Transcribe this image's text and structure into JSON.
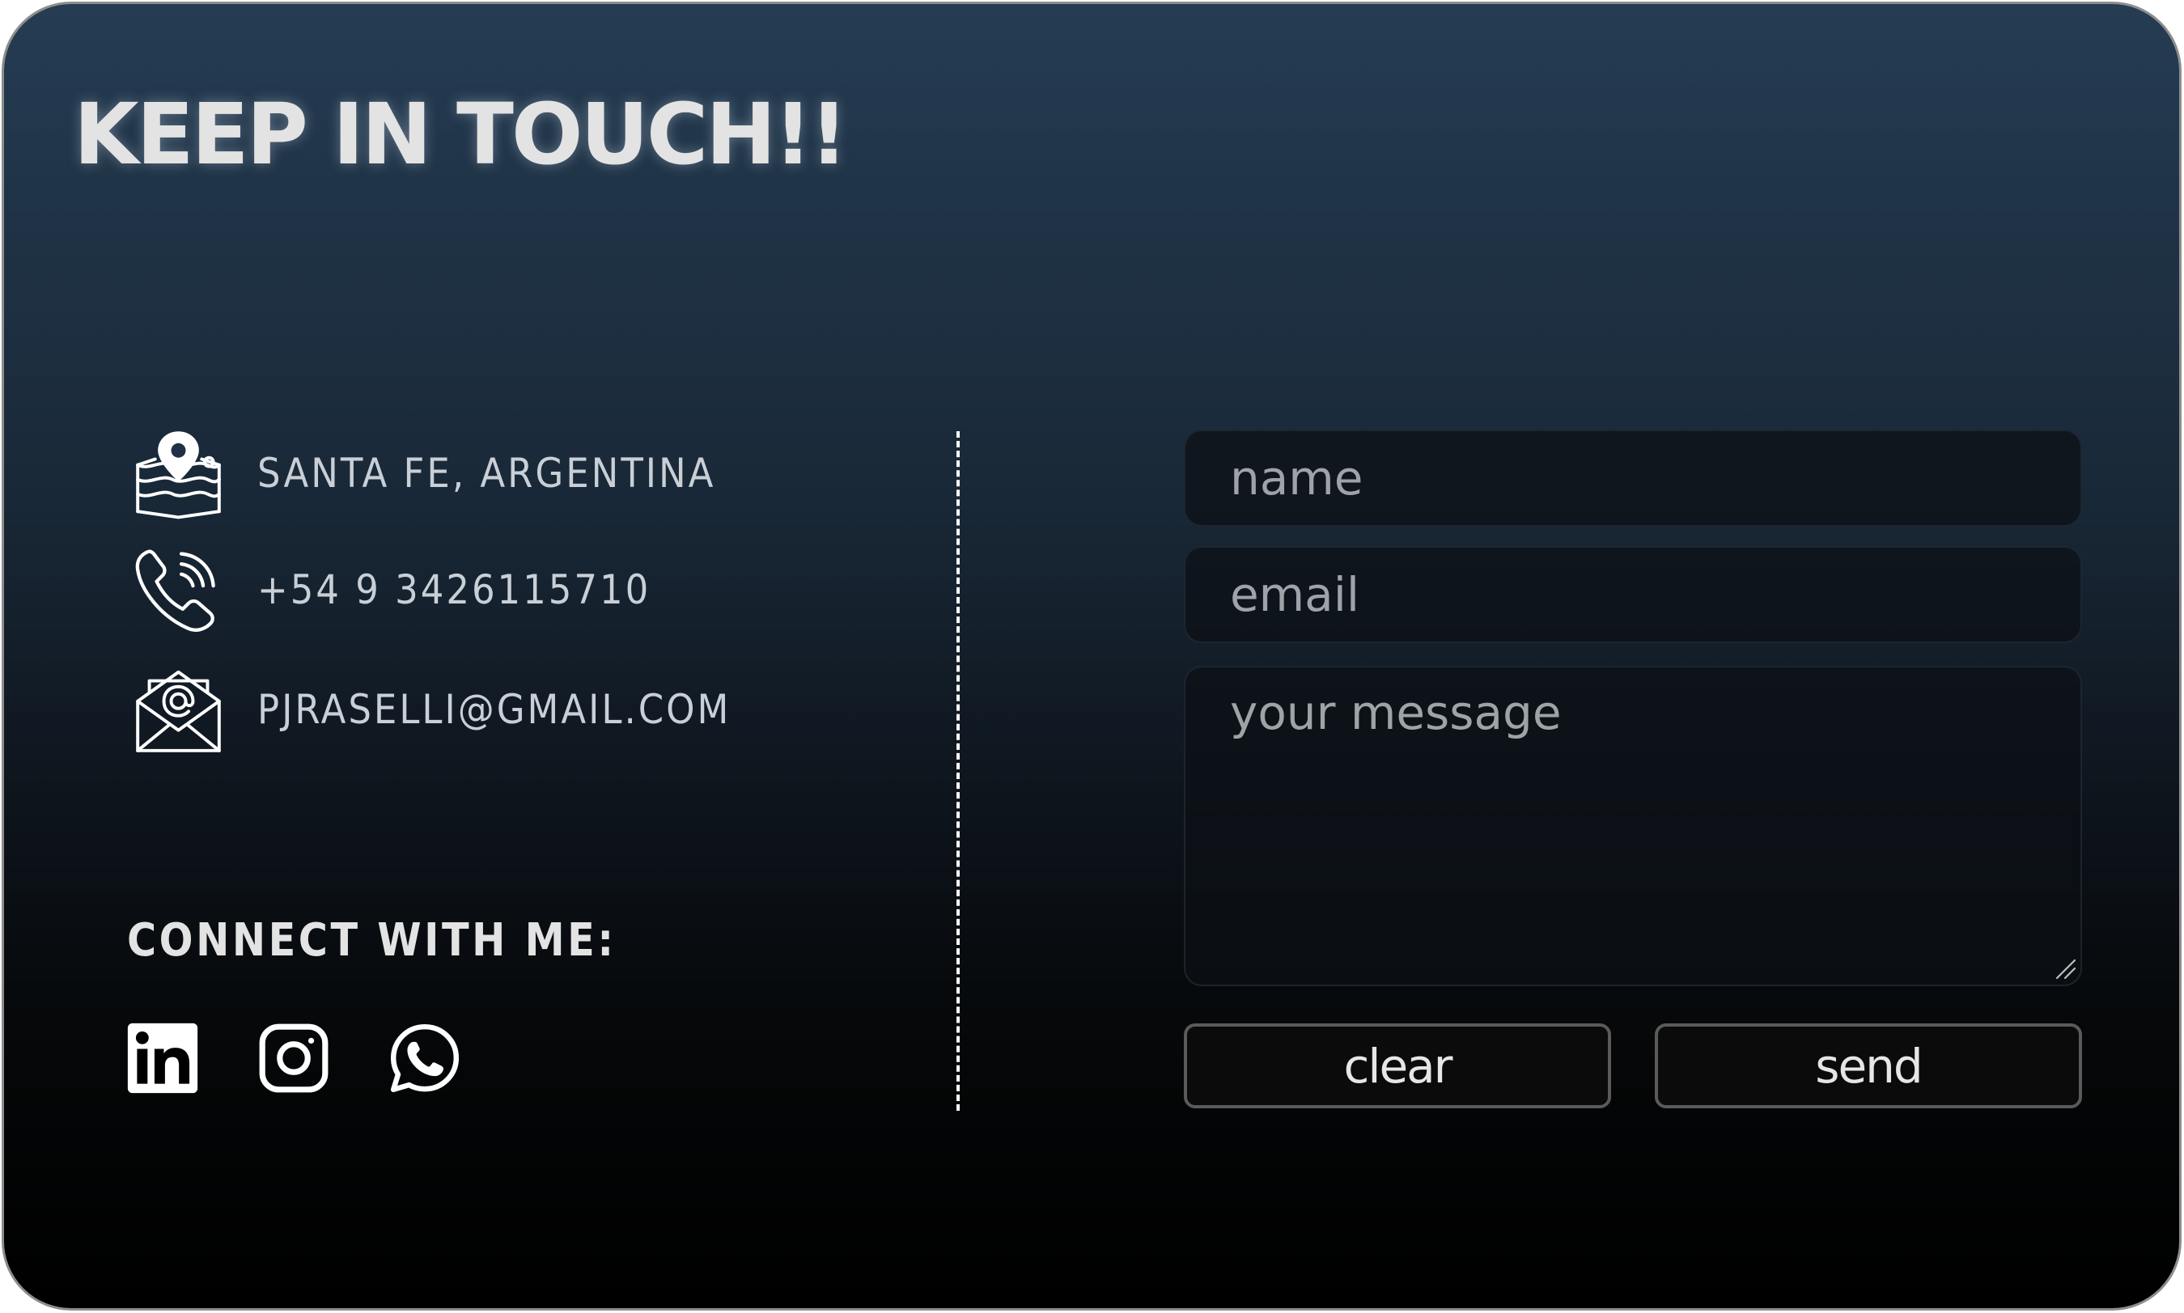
{
  "title": "KEEP IN TOUCH!!",
  "contact": {
    "location": {
      "icon": "map-pin-icon",
      "text": "SANTA FE, ARGENTINA"
    },
    "phone": {
      "icon": "phone-icon",
      "text": "+54 9 3426115710"
    },
    "email": {
      "icon": "envelope-icon",
      "text": "PJRASELLI@GMAIL.COM"
    }
  },
  "connect": {
    "label": "CONNECT WITH ME:",
    "socials": [
      {
        "icon": "linkedin-icon"
      },
      {
        "icon": "instagram-icon"
      },
      {
        "icon": "whatsapp-icon"
      }
    ]
  },
  "form": {
    "name_placeholder": "name",
    "email_placeholder": "email",
    "message_placeholder": "your message",
    "clear_label": "clear",
    "send_label": "send"
  },
  "colors": {
    "card_top": "#253c53",
    "card_bottom": "#000000",
    "text": "#e3e3e3",
    "button_border": "#5a5a5a"
  }
}
